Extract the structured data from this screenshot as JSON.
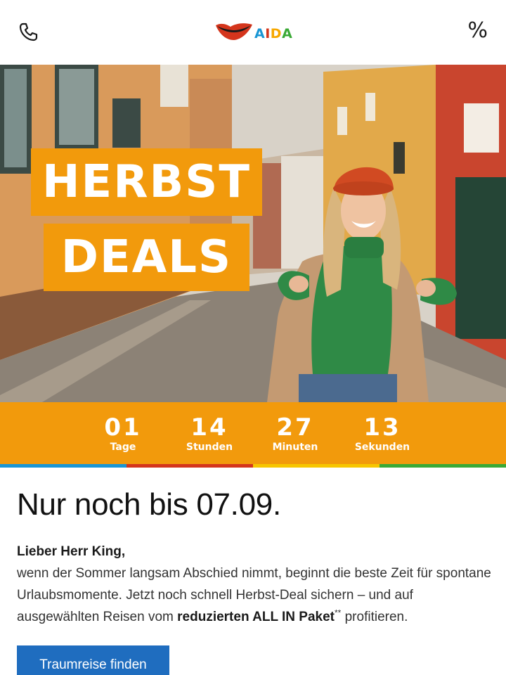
{
  "header": {
    "phone_icon": "phone-icon",
    "logo_text": "AIDA",
    "percent_label": "%"
  },
  "hero": {
    "deal_line_1": "HERBST",
    "deal_line_2": "DEALS"
  },
  "countdown": {
    "units": [
      {
        "value": "01",
        "label": "Tage"
      },
      {
        "value": "14",
        "label": "Stunden"
      },
      {
        "value": "27",
        "label": "Minuten"
      },
      {
        "value": "13",
        "label": "Sekunden"
      }
    ]
  },
  "content": {
    "headline": "Nur noch bis 07.09.",
    "salutation": "Lieber Herr King,",
    "paragraph_start": "wenn der Sommer langsam Abschied nimmt, beginnt die beste Zeit für spontane Urlaubsmomente. Jetzt noch schnell Herbst-Deal sichern – und auf ausgewählten Reisen vom ",
    "paragraph_bold": "reduzierten ALL IN Paket",
    "paragraph_sup": "**",
    "paragraph_end": " profitieren.",
    "cta_label": "Traumreise finden"
  },
  "colors": {
    "brand_orange": "#f29a0c",
    "cta_blue": "#1f6dbf",
    "stripe_blue": "#1a96d4",
    "stripe_red": "#d4351c",
    "stripe_yellow": "#f7c600",
    "stripe_green": "#3aa935"
  }
}
